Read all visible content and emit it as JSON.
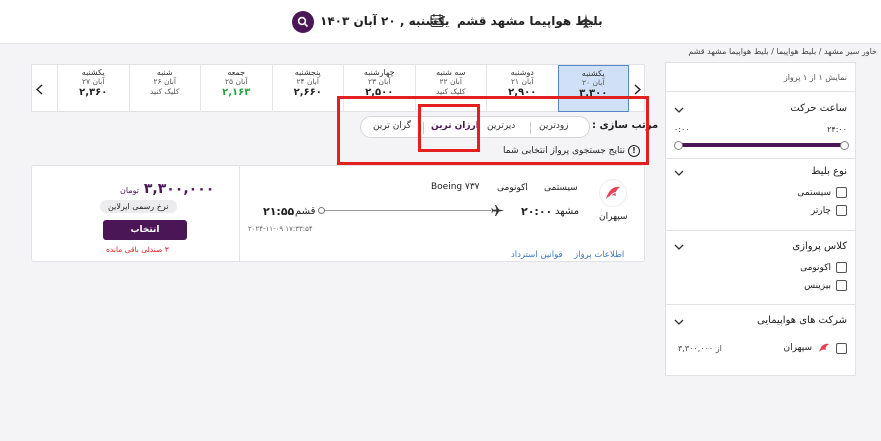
{
  "header": {
    "date_text": "یکشنبه , ۲۰ آبان ۱۴۰۳",
    "title": "بلیط هواپیما مشهد قشم"
  },
  "breadcrumb": "خاور سیر مشهد / بلیط هواپیما / بلیط هواپیما مشهد قشم",
  "sidebar": {
    "count_text": "نمایش ۱ از ۱ پرواز",
    "departure_time": {
      "title": "ساعت حرکت",
      "max": "۲۴:۰۰",
      "min": "۰:۰۰"
    },
    "ticket_type": {
      "title": "نوع بلیط",
      "options": [
        "سیستمی",
        "چارتر"
      ]
    },
    "flight_class": {
      "title": "کلاس پروازی",
      "options": [
        "اکونومی",
        "بیزینس"
      ]
    },
    "airlines": {
      "title": "شرکت های هواپیمایی",
      "items": [
        {
          "name": "سپهران",
          "price": "از ۳,۳۰۰,۰۰۰"
        }
      ]
    }
  },
  "dates": [
    {
      "day": "یکشنبه",
      "date": "۲۰ آبان",
      "price": "۳,۳۰۰",
      "selected": true
    },
    {
      "day": "دوشنبه",
      "date": "۲۱ آبان",
      "price": "۲,۹۰۰"
    },
    {
      "day": "سه شنبه",
      "date": "۲۲ آبان",
      "price": "کلیک کنید",
      "click": true
    },
    {
      "day": "چهارشنبه",
      "date": "۲۳ آبان",
      "price": "۲,۵۰۰"
    },
    {
      "day": "پنجشنبه",
      "date": "۲۴ آبان",
      "price": "۲,۶۶۰"
    },
    {
      "day": "جمعه",
      "date": "۲۵ آبان",
      "price": "۲,۱۶۳",
      "green": true
    },
    {
      "day": "شنبه",
      "date": "۲۶ آبان",
      "price": "کلیک کنید",
      "click": true
    },
    {
      "day": "یکشنبه",
      "date": "۲۷ آبان",
      "price": "۲,۳۶۰"
    }
  ],
  "sort": {
    "label": "مرتب سازی :",
    "options": [
      "زودترین",
      "دیرترین",
      "ارزان ترین",
      "گران ترین"
    ],
    "active": "ارزان ترین",
    "note": "نتایج جستجوی پرواز انتخابی شما"
  },
  "flight": {
    "airline": "سپهران",
    "type": "سیستمی",
    "class": "اکونومی",
    "aircraft": "Boeing ۷۳۷",
    "origin": "مشهد",
    "depart_time": "۲۰:۰۰",
    "destination": "قشم",
    "arrive_time": "۲۱:۵۵",
    "timestamp": "۲۰۲۴-۱۱-۰۹ ۱۷:۳۳:۵۴",
    "price": "۳,۳۰۰,۰۰۰",
    "currency": "تومان",
    "fare_tag": "نرخ رسمی ایرلاین",
    "select_label": "انتخاب",
    "seats_left": "۳ صندلی باقی مانده",
    "links": {
      "flight_info": "اطلاعات پرواز",
      "refund_rules": "قوانین استرداد"
    }
  },
  "colors": {
    "brand": "#4b1656",
    "highlight": "#e3201f",
    "selected_day": "#cfe0f7",
    "green_price": "#2aa140",
    "link": "#3a78c2"
  },
  "icons": [
    "search-icon",
    "calendar-icon",
    "plane-icon",
    "chevron-down-icon",
    "chevron-left-icon",
    "chevron-right-icon",
    "info-icon",
    "airline-logo-icon"
  ]
}
